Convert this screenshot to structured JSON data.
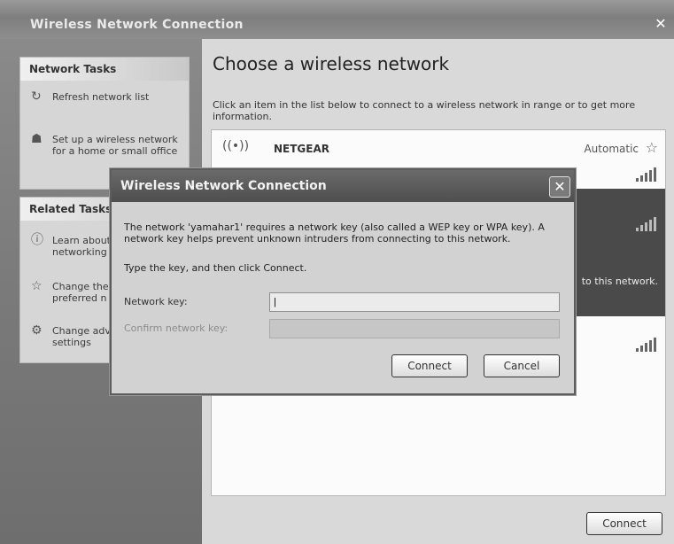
{
  "window": {
    "title": "Wireless Network Connection",
    "close_glyph": "✕"
  },
  "network_tasks": {
    "header": "Network Tasks",
    "items": [
      {
        "label_1": "Refresh network list",
        "label_2": "",
        "icon": "refresh-icon"
      },
      {
        "label_1": "Set up a wireless network",
        "label_2": "for a home or small office",
        "icon": "setup-network-icon"
      }
    ]
  },
  "related_tasks": {
    "header": "Related Tasks",
    "items": [
      {
        "label_1": "Learn about",
        "label_2": "networking",
        "icon": "info-icon"
      },
      {
        "label_1": "Change the",
        "label_2": "preferred n",
        "icon": "star-icon"
      },
      {
        "label_1": "Change adv",
        "label_2": "settings",
        "icon": "gear-icon"
      }
    ]
  },
  "main": {
    "heading": "Choose a wireless network",
    "instructions": "Click an item in the list below to connect to a wireless network in range or to get more information.",
    "networks": [
      {
        "name": "NETGEAR",
        "status": "Automatic",
        "star": "☆"
      }
    ],
    "row2_text_fragment": "to this network.",
    "connect_label": "Connect"
  },
  "dialog": {
    "title": "Wireless Network Connection",
    "close_glyph": "✕",
    "message": "The network 'yamahar1' requires a network key (also called a WEP key or WPA key). A network key helps prevent unknown intruders from connecting to this network.",
    "message2": "Type the key, and then click Connect.",
    "network_key_label": "Network key:",
    "network_key_value": "|",
    "confirm_key_label": "Confirm network key:",
    "confirm_key_value": "",
    "connect_label": "Connect",
    "cancel_label": "Cancel"
  }
}
